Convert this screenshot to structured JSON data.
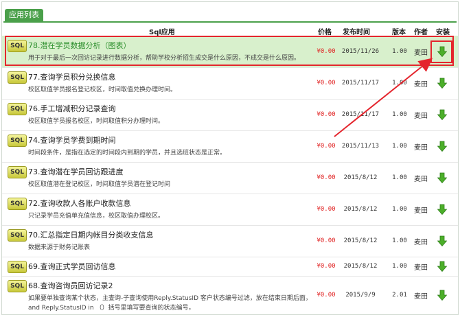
{
  "panel_title": "应用列表",
  "columns": {
    "app": "Sql应用",
    "price": "价格",
    "date": "发布时间",
    "version": "版本",
    "author": "作者",
    "install": "安装"
  },
  "badge_label": "SQL",
  "colors": {
    "accent": "#4aa04a",
    "highlight": "#d8f0cc",
    "price": "#e02020",
    "annotation": "#e4252d"
  },
  "rows": [
    {
      "title": "78.潜在学员数据分析（图表）",
      "desc": "用于对于最后一次回访记录进行数据分析，帮助学校分析招生成交是什么原因，不成交是什么原因。",
      "price": "¥0.00",
      "date": "2015/11/26",
      "version": "1.00",
      "author": "麦田"
    },
    {
      "title": "77.查询学员积分兑换信息",
      "desc": "校区取值学员报名登记校区，时间取值兑换办理时间。",
      "price": "¥0.00",
      "date": "2015/11/17",
      "version": "1.00",
      "author": "麦田"
    },
    {
      "title": "76.手工增减积分记录查询",
      "desc": "校区取值学员报名校区，时间取值积分办理时间。",
      "price": "¥0.00",
      "date": "2015/11/17",
      "version": "1.00",
      "author": "麦田"
    },
    {
      "title": "74.查询学员学费到期时间",
      "desc": "时间段条件，是指在选定的时间段内到期的学员，并且选班状态是正常。",
      "price": "¥0.00",
      "date": "2015/11/13",
      "version": "1.00",
      "author": "麦田"
    },
    {
      "title": "73.查询潜在学员回访跟进度",
      "desc": "校区取值潜在登记校区，时间取值学员潜在登记时间",
      "price": "¥0.00",
      "date": "2015/8/12",
      "version": "1.00",
      "author": "麦田"
    },
    {
      "title": "72.查询收款人各账户收款信息",
      "desc": "只记录学员充值单充值信息，校区取值办理校区。",
      "price": "¥0.00",
      "date": "2015/8/12",
      "version": "1.00",
      "author": "麦田"
    },
    {
      "title": "70.汇总指定日期内帐目分类收支信息",
      "desc": "数据来源于财务记账表",
      "price": "¥0.00",
      "date": "2015/8/12",
      "version": "1.00",
      "author": "麦田"
    },
    {
      "title": "69.查询正式学员回访信息",
      "desc": "",
      "price": "¥0.00",
      "date": "2015/8/12",
      "version": "1.00",
      "author": "麦田"
    },
    {
      "title": "68.查询咨询员回访记录2",
      "desc": "如果要单独查询某个状态，主查询-子查询使用Reply.StatusID 客户状态编号过滤，放在结束日期后面，and Reply.StatusID in （）括号里填写要查询的状态编号，",
      "price": "¥0.00",
      "date": "2015/9/9",
      "version": "2.01",
      "author": "麦田"
    }
  ]
}
